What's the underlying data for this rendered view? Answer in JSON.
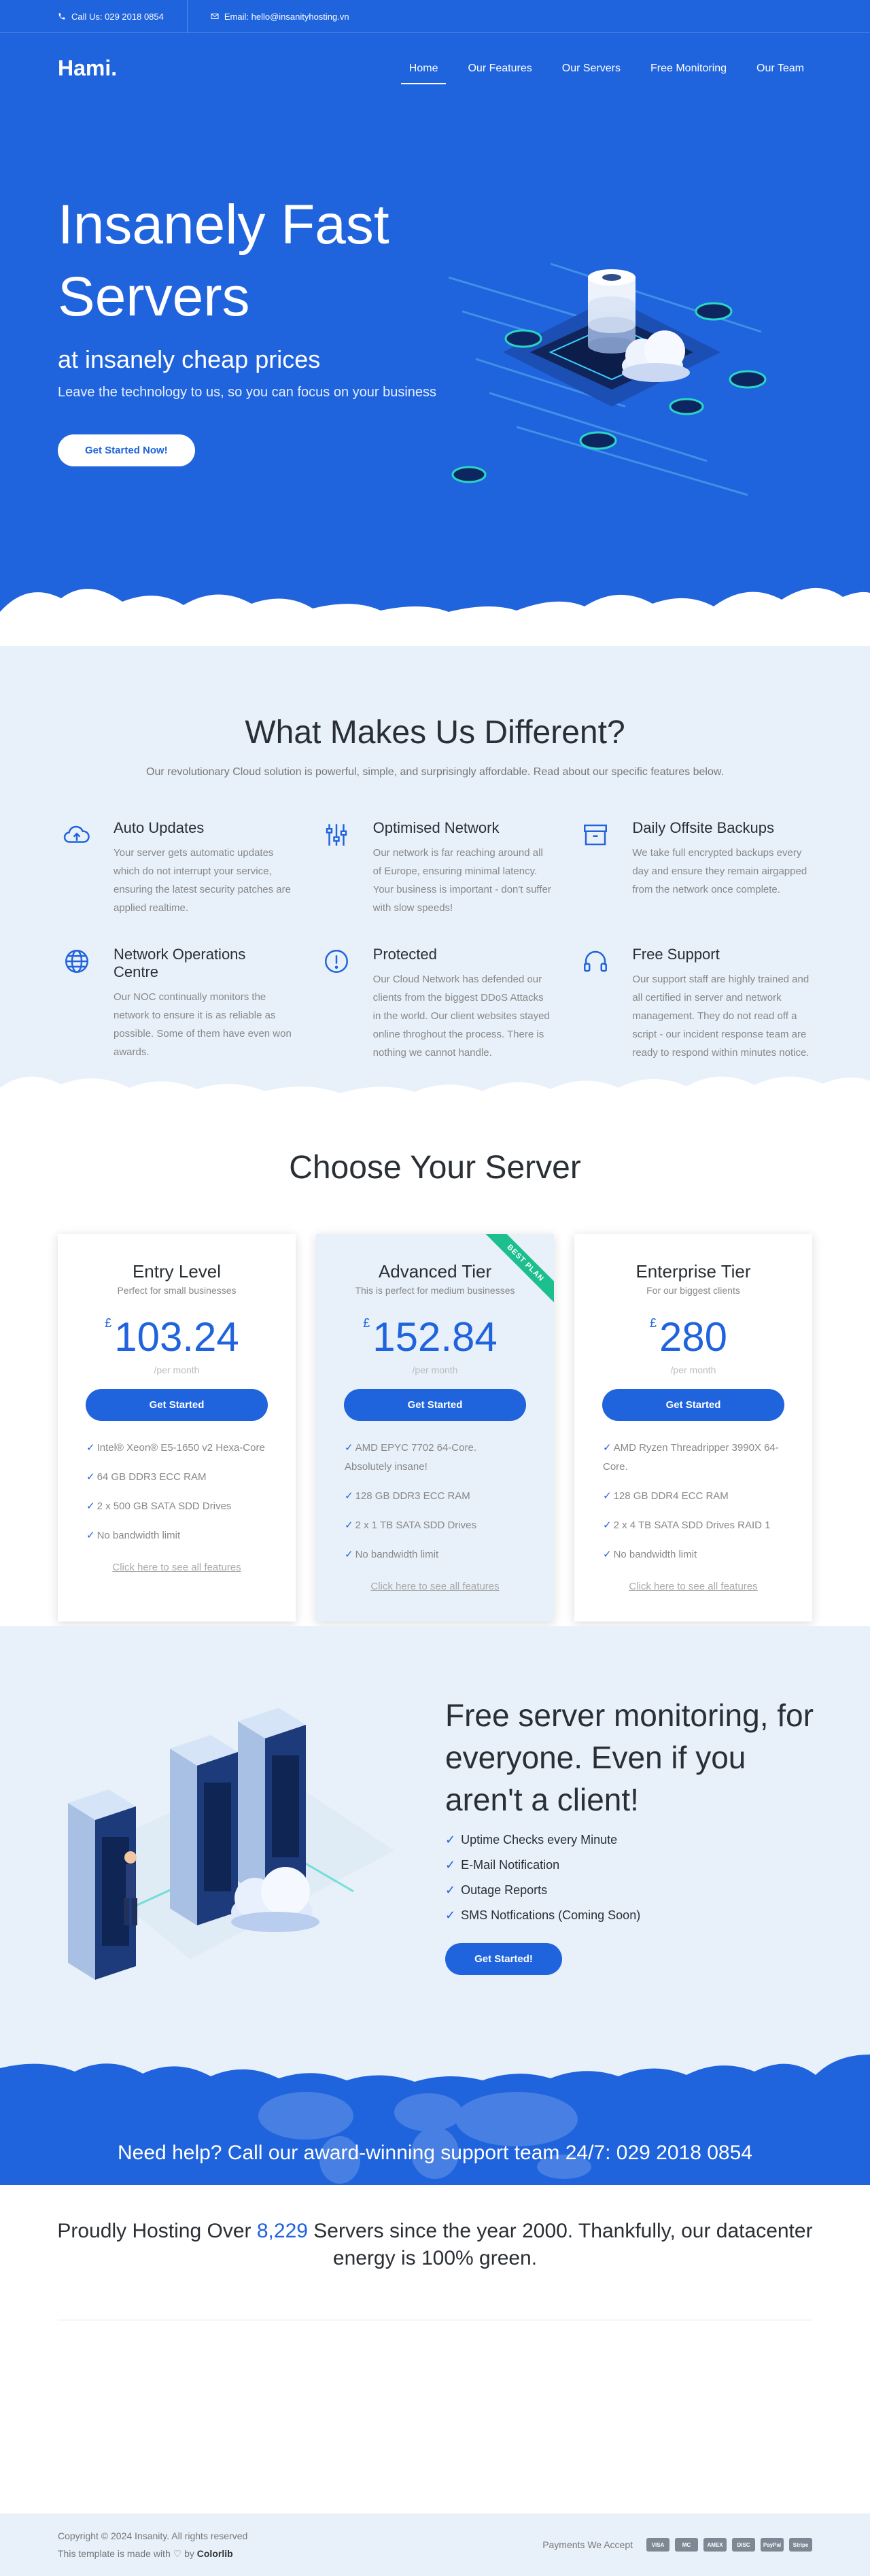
{
  "topbar": {
    "phone": "Call Us: 029 2018 0854",
    "email": "Email: hello@insanityhosting.vn"
  },
  "nav": {
    "logo": "Hami.",
    "items": [
      "Home",
      "Our Features",
      "Our Servers",
      "Free Monitoring",
      "Our Team"
    ]
  },
  "hero": {
    "title": "Insanely Fast Servers",
    "subtitle": "at insanely cheap prices",
    "lead": "Leave the technology to us, so you can focus on your business",
    "cta": "Get Started Now!"
  },
  "features": {
    "title": "What Makes Us Different?",
    "lead": "Our revolutionary Cloud solution is powerful, simple, and surprisingly affordable. Read about our specific features below.",
    "items": [
      {
        "icon": "cloud-upload-icon",
        "title": "Auto Updates",
        "text": "Your server gets automatic updates which do not interrupt your service, ensuring the latest security patches are applied realtime."
      },
      {
        "icon": "sliders-icon",
        "title": "Optimised Network",
        "text": "Our network is far reaching around all of Europe, ensuring minimal latency. Your business is important - don't suffer with slow speeds!"
      },
      {
        "icon": "archive-icon",
        "title": "Daily Offsite Backups",
        "text": "We take full encrypted backups every day and ensure they remain airgapped from the network once complete."
      },
      {
        "icon": "globe-icon",
        "title": "Network Operations Centre",
        "text": "Our NOC continually monitors the network to ensure it is as reliable as possible. Some of them have even won awards."
      },
      {
        "icon": "alert-icon",
        "title": "Protected",
        "text": "Our Cloud Network has defended our clients from the biggest DDoS Attacks in the world. Our client websites stayed online throghout the process. There is nothing we cannot handle."
      },
      {
        "icon": "headphones-icon",
        "title": "Free Support",
        "text": "Our support staff are highly trained and all certified in server and network management. They do not read off a script - our incident response team are ready to respond within minutes notice."
      }
    ]
  },
  "pricing": {
    "title": "Choose Your Server",
    "plans": [
      {
        "name": "Entry Level",
        "tag": "Perfect for small businesses",
        "currency": "£",
        "price": "103.24",
        "per": "/per month",
        "cta": "Get Started",
        "specs": [
          "Intel® Xeon® E5-1650 v2 Hexa-Core",
          "64 GB DDR3 ECC RAM",
          "2 x 500 GB SATA SDD Drives",
          "No bandwidth limit"
        ],
        "link": "Click here to see all features"
      },
      {
        "name": "Advanced Tier",
        "tag": "This is perfect for medium businesses",
        "currency": "£",
        "price": "152.84",
        "per": "/per month",
        "cta": "Get Started",
        "ribbon": "BEST PLAN",
        "specs": [
          "AMD EPYC 7702 64-Core. Absolutely insane!",
          "128 GB DDR3 ECC RAM",
          "2 x 1 TB SATA SDD Drives",
          "No bandwidth limit"
        ],
        "link": "Click here to see all features"
      },
      {
        "name": "Enterprise Tier",
        "tag": "For our biggest clients",
        "currency": "£",
        "price": "280",
        "per": "/per month",
        "cta": "Get Started",
        "specs": [
          "AMD Ryzen Threadripper 3990X 64-Core.",
          "128 GB DDR4 ECC RAM",
          "2 x 4 TB SATA SDD Drives RAID 1",
          "No bandwidth limit"
        ],
        "link": "Click here to see all features"
      }
    ]
  },
  "monitor": {
    "title": "Free server monitoring, for everyone. Even if you aren't a client!",
    "items": [
      "Uptime Checks every Minute",
      "E-Mail Notification",
      "Outage Reports",
      "SMS Notfications (Coming Soon)"
    ],
    "cta": "Get Started!"
  },
  "support": {
    "text": "Need help? Call our award-winning support team 24/7: 029 2018 0854"
  },
  "hosting": {
    "before": "Proudly Hosting Over ",
    "count": "8,229",
    "after": " Servers since the year 2000. Thankfully, our datacenter energy is 100% green."
  },
  "footer": {
    "copyright": "Copyright © 2024 Insanity. All rights reserved",
    "made_prefix": "This template is made with",
    "made_by": "by",
    "brand": "Colorlib",
    "payments_label": "Payments We Accept",
    "payments": [
      "VISA",
      "MC",
      "AMEX",
      "DISC",
      "PayPal",
      "Stripe"
    ]
  },
  "colors": {
    "brand": "#1f63dd",
    "light_bg": "#e8f0f9",
    "ribbon": "#1dbf8f"
  }
}
